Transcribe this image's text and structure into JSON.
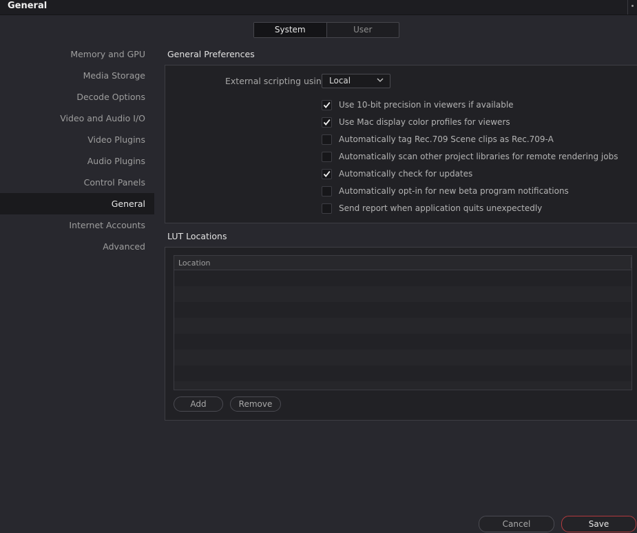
{
  "window": {
    "title": "General"
  },
  "tabs": [
    {
      "label": "System",
      "active": true
    },
    {
      "label": "User",
      "active": false
    }
  ],
  "sidebar": {
    "items": [
      {
        "label": "Memory and GPU"
      },
      {
        "label": "Media Storage"
      },
      {
        "label": "Decode Options"
      },
      {
        "label": "Video and Audio I/O"
      },
      {
        "label": "Video Plugins"
      },
      {
        "label": "Audio Plugins"
      },
      {
        "label": "Control Panels"
      },
      {
        "label": "General",
        "selected": true
      },
      {
        "label": "Internet Accounts"
      },
      {
        "label": "Advanced"
      }
    ]
  },
  "general_preferences": {
    "title": "General Preferences",
    "scripting_label": "External scripting using",
    "scripting_value": "Local",
    "options": [
      {
        "label": "Use 10-bit precision in viewers if available",
        "checked": true
      },
      {
        "label": "Use Mac display color profiles for viewers",
        "checked": true
      },
      {
        "label": "Automatically tag Rec.709 Scene clips as Rec.709-A",
        "checked": false
      },
      {
        "label": "Automatically scan other project libraries for remote rendering jobs",
        "checked": false
      },
      {
        "label": "Automatically check for updates",
        "checked": true
      },
      {
        "label": "Automatically opt-in for new beta program notifications",
        "checked": false
      },
      {
        "label": "Send report when application quits unexpectedly",
        "checked": false
      }
    ]
  },
  "lut_locations": {
    "title": "LUT Locations",
    "column_header": "Location",
    "rows": [],
    "add_label": "Add",
    "remove_label": "Remove"
  },
  "footer": {
    "cancel_label": "Cancel",
    "save_label": "Save"
  },
  "colors": {
    "accent_save_border": "#b43a3e",
    "background": "#28282e",
    "selected_item": "#1a1a1d"
  },
  "icons": {
    "checkbox_checked": "checkmark-icon",
    "dropdown": "chevron-down-icon"
  }
}
